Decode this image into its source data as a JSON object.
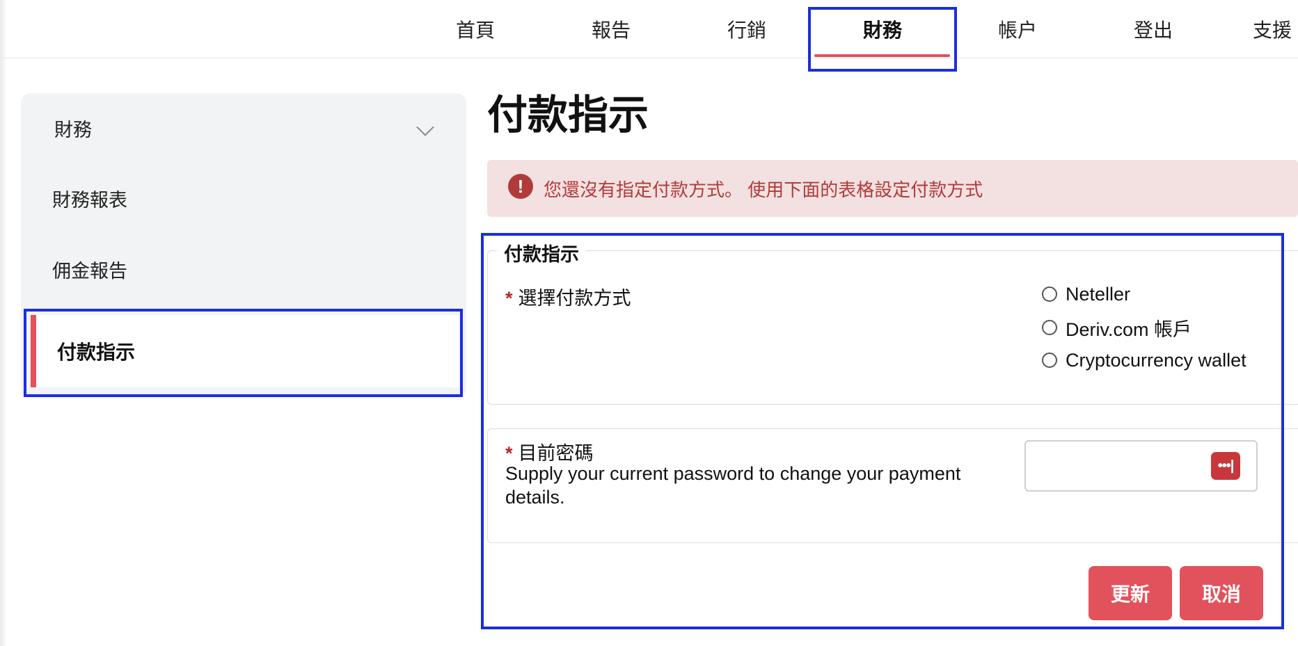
{
  "nav": {
    "items": [
      {
        "label": "首頁"
      },
      {
        "label": "報告"
      },
      {
        "label": "行銷"
      },
      {
        "label": "財務"
      },
      {
        "label": "帳户"
      },
      {
        "label": "登出"
      },
      {
        "label": "支援"
      }
    ],
    "active": "財務"
  },
  "sidebar": {
    "header": "財務",
    "items": [
      {
        "label": "財務報表"
      },
      {
        "label": "佣金報告"
      },
      {
        "label": "付款指示"
      }
    ],
    "active": "付款指示"
  },
  "main": {
    "title": "付款指示",
    "alert": "您還沒有指定付款方式。 使用下面的表格設定付款方式",
    "form": {
      "legend": "付款指示",
      "required_mark": "*",
      "method_label": "選擇付款方式",
      "methods": [
        {
          "label": "Neteller"
        },
        {
          "label": "Deriv.com 帳戶"
        },
        {
          "label": "Cryptocurrency wallet"
        }
      ],
      "password_label": "目前密碼",
      "password_help": "Supply your current password to change your payment details.",
      "password_value": "",
      "password_manager_icon": "•••|"
    },
    "buttons": {
      "update": "更新",
      "cancel": "取消"
    }
  },
  "colors": {
    "accent": "#e2525c",
    "alert_bg": "#f3e1e1",
    "alert_text": "#b13a3a",
    "highlight_box": "#1a2ee0"
  }
}
